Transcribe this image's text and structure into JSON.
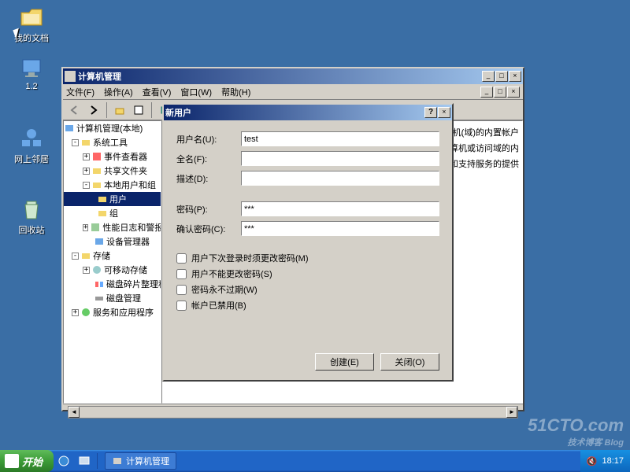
{
  "desktop": {
    "icons": [
      {
        "label": "我的文档",
        "color": "#f3d66b"
      },
      {
        "label": "1.2",
        "color": "#6aa7e8"
      },
      {
        "label": "网上邻居",
        "color": "#6aa7e8"
      },
      {
        "label": "回收站",
        "color": "#cfe8cf"
      }
    ]
  },
  "mgmt": {
    "title": "计算机管理",
    "menu": {
      "file": "文件(F)",
      "action": "操作(A)",
      "view": "查看(V)",
      "window": "窗口(W)",
      "help": "帮助(H)"
    },
    "tree": {
      "root": "计算机管理(本地)",
      "sys_tools": "系统工具",
      "event_viewer": "事件查看器",
      "shared": "共享文件夹",
      "local_users": "本地用户和组",
      "users": "用户",
      "groups": "组",
      "perf": "性能日志和警报",
      "devmgr": "设备管理器",
      "storage": "存储",
      "removable": "可移动存储",
      "defrag": "磁盘碎片整理程序",
      "diskmgmt": "磁盘管理",
      "services": "服务和应用程序"
    },
    "list_text": {
      "l1": "机(域)的内置帐户",
      "l2": "问计算机或访问域的内",
      "l3": "助和支持服务的提供"
    }
  },
  "dialog": {
    "title": "新用户",
    "labels": {
      "username": "用户名(U):",
      "fullname": "全名(F):",
      "description": "描述(D):",
      "password": "密码(P):",
      "confirm": "确认密码(C):"
    },
    "values": {
      "username": "test",
      "fullname": "",
      "description": "",
      "password": "***",
      "confirm": "***"
    },
    "checks": {
      "must_change": "用户下次登录时须更改密码(M)",
      "cannot_change": "用户不能更改密码(S)",
      "never_expire": "密码永不过期(W)",
      "disabled": "帐户已禁用(B)"
    },
    "buttons": {
      "create": "创建(E)",
      "close": "关闭(O)"
    }
  },
  "taskbar": {
    "start": "开始",
    "task1": "计算机管理",
    "clock": "18:17"
  },
  "watermark": {
    "main": "51CTO.com",
    "sub": "技术博客  Blog"
  }
}
